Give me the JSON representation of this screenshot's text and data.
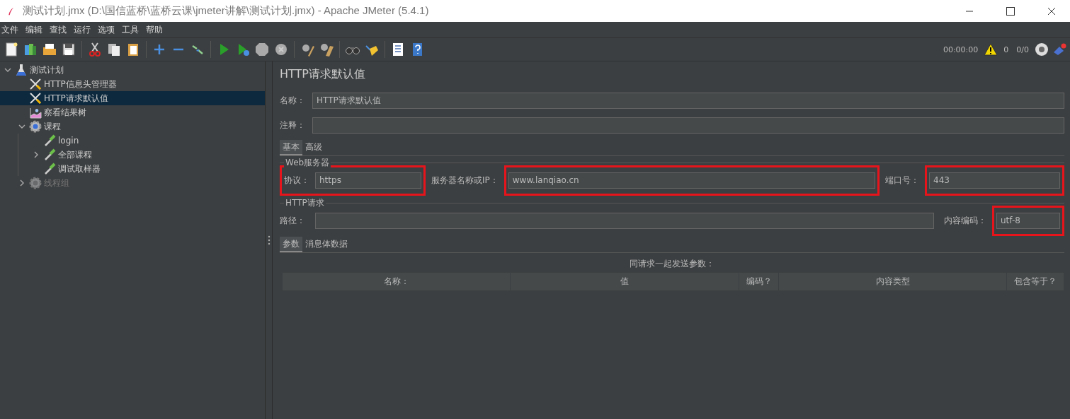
{
  "window": {
    "title": "测试计划.jmx (D:\\国信蓝桥\\蓝桥云课\\jmeter讲解\\测试计划.jmx) - Apache JMeter (5.4.1)"
  },
  "menu": [
    "文件",
    "编辑",
    "查找",
    "运行",
    "选项",
    "工具",
    "帮助"
  ],
  "status": {
    "time": "00:00:00",
    "warnings": "0",
    "threads": "0/0"
  },
  "tree": [
    {
      "label": "测试计划",
      "kind": "plan",
      "expanded": true,
      "selected": false,
      "disabled": false,
      "children": [
        {
          "label": "HTTP信息头管理器",
          "kind": "config",
          "selected": false,
          "disabled": false
        },
        {
          "label": "HTTP请求默认值",
          "kind": "config",
          "selected": true,
          "disabled": false
        },
        {
          "label": "察看结果树",
          "kind": "listener",
          "selected": false,
          "disabled": false
        },
        {
          "label": "课程",
          "kind": "thread-group",
          "expanded": true,
          "selected": false,
          "disabled": false,
          "children": [
            {
              "label": "login",
              "kind": "sampler",
              "selected": false,
              "disabled": false
            },
            {
              "label": "全部课程",
              "kind": "sampler",
              "expanded": false,
              "selected": false,
              "disabled": false
            },
            {
              "label": "调试取样器",
              "kind": "sampler",
              "selected": false,
              "disabled": false
            }
          ]
        },
        {
          "label": "线程组",
          "kind": "thread-group",
          "expanded": false,
          "selected": false,
          "disabled": true
        }
      ]
    }
  ],
  "panel": {
    "title": "HTTP请求默认值",
    "name": {
      "label": "名称：",
      "value": "HTTP请求默认值"
    },
    "comment": {
      "label": "注释："
    },
    "tabs": [
      {
        "label": "基本",
        "selected": true
      },
      {
        "label": "高级",
        "selected": false
      }
    ],
    "web_server": {
      "legend": "Web服务器",
      "protocol": {
        "label": "协议：",
        "value": "https",
        "highlighted": true
      },
      "server": {
        "label": "服务器名称或IP：",
        "value": "www.lanqiao.cn",
        "highlighted": true
      },
      "port": {
        "label": "端口号：",
        "value": "443",
        "highlighted": true
      }
    },
    "http_request": {
      "legend": "HTTP请求",
      "path": {
        "label": "路径：",
        "highlighted": false
      },
      "encoding": {
        "label": "内容编码：",
        "value": "utf-8",
        "highlighted": true
      }
    },
    "sub_tabs": [
      {
        "label": "参数",
        "selected": true
      },
      {
        "label": "消息体数据",
        "selected": false
      }
    ],
    "params_caption": "同请求一起发送参数：",
    "columns": [
      "名称：",
      "值",
      "编码？",
      "内容类型",
      "包含等于？"
    ]
  }
}
